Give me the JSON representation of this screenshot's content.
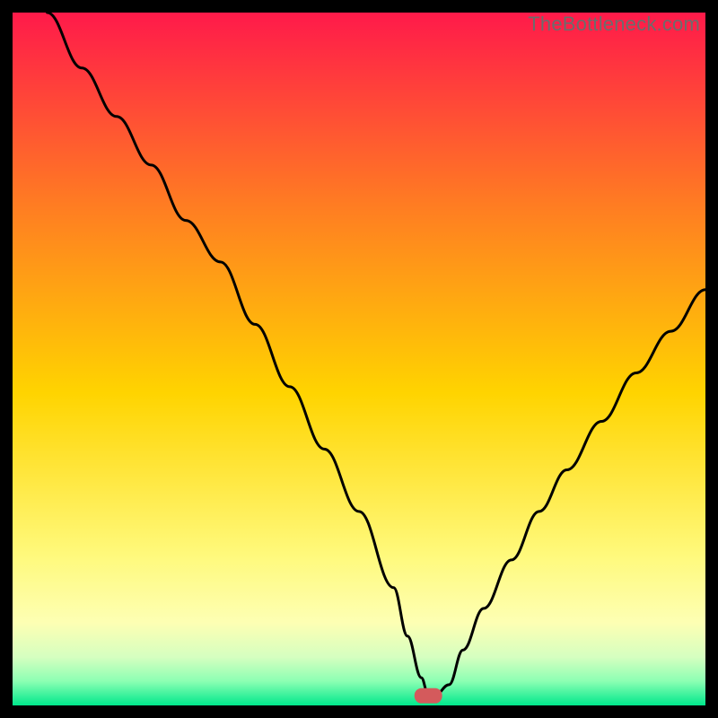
{
  "watermark": {
    "text": "TheBottleneck.com"
  },
  "colors": {
    "bg_top": "#ff1a4a",
    "bg_q1": "#ff7d22",
    "bg_mid": "#ffd400",
    "bg_q3_a": "#fff97a",
    "bg_q3_b": "#fdffb3",
    "bg_low_a": "#d6ffc0",
    "bg_low_b": "#8cffb3",
    "bg_bottom": "#00e88c",
    "curve": "#000000",
    "marker": "#d45a5c"
  },
  "chart_data": {
    "type": "line",
    "title": "",
    "xlabel": "",
    "ylabel": "",
    "xlim": [
      0,
      100
    ],
    "ylim": [
      0,
      100
    ],
    "grid": false,
    "legend": false,
    "series": [
      {
        "name": "bottleneck-curve",
        "x": [
          5,
          10,
          15,
          20,
          25,
          30,
          35,
          40,
          45,
          50,
          55,
          57,
          59,
          60,
          61,
          63,
          65,
          68,
          72,
          76,
          80,
          85,
          90,
          95,
          100
        ],
        "y": [
          100,
          92,
          85,
          78,
          70,
          64,
          55,
          46,
          37,
          28,
          17,
          10,
          4,
          1.5,
          1.5,
          3,
          8,
          14,
          21,
          28,
          34,
          41,
          48,
          54,
          60
        ]
      }
    ],
    "marker": {
      "x_center": 60,
      "width": 4,
      "height": 2.2,
      "y": 1.4
    },
    "annotations": []
  }
}
